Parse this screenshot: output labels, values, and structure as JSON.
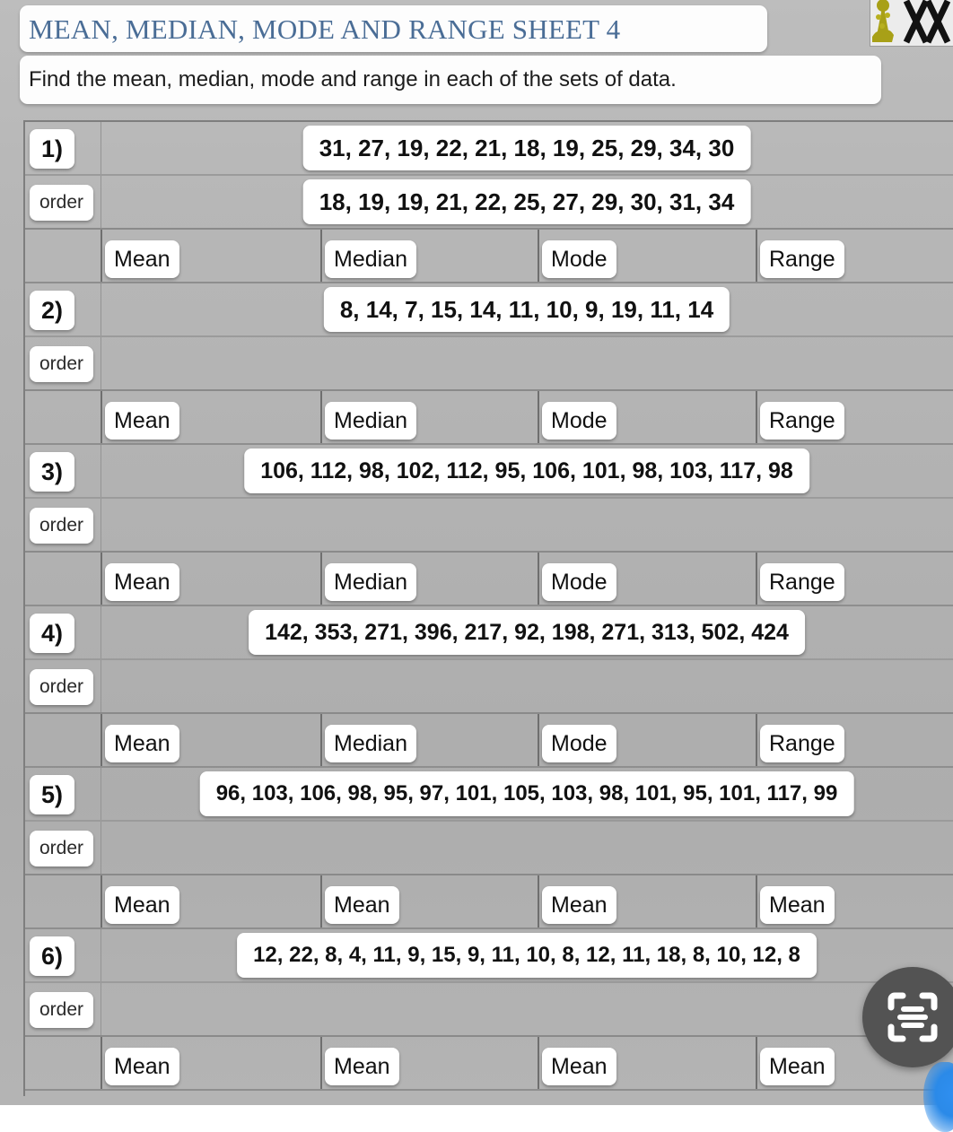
{
  "header": {
    "title": "MEAN, MEDIAN, MODE AND RANGE SHEET 4",
    "subtitle": "Find the mean, median, mode and range in each of the sets of data.",
    "title_color": "#4a6d96",
    "logo_icon": "math-salamanders-logo"
  },
  "table": {
    "order_label": "order",
    "groups": [
      {
        "number": "1)",
        "data": "31, 27, 19, 22, 21, 18, 19, 25, 29, 34, 30",
        "order": "18, 19, 19, 21, 22, 25, 27, 29, 30, 31, 34",
        "labels": [
          "Mean",
          "Median",
          "Mode",
          "Range"
        ]
      },
      {
        "number": "2)",
        "data": "8, 14, 7, 15, 14, 11, 10, 9, 19, 11, 14",
        "order": "",
        "labels": [
          "Mean",
          "Median",
          "Mode",
          "Range"
        ]
      },
      {
        "number": "3)",
        "data": "106, 112, 98, 102, 112, 95, 106, 101, 98, 103, 117, 98",
        "order": "",
        "labels": [
          "Mean",
          "Median",
          "Mode",
          "Range"
        ]
      },
      {
        "number": "4)",
        "data": "142, 353, 271, 396, 217, 92, 198, 271, 313, 502, 424",
        "order": "",
        "labels": [
          "Mean",
          "Median",
          "Mode",
          "Range"
        ]
      },
      {
        "number": "5)",
        "data": "96, 103, 106, 98, 95, 97, 101, 105, 103, 98, 101, 95, 101, 117, 99",
        "order": "",
        "labels": [
          "Mean",
          "Mean",
          "Mean",
          "Mean"
        ]
      },
      {
        "number": "6)",
        "data": "12, 22, 8, 4, 11, 9, 15, 9, 11, 10, 8, 12, 11, 18, 8, 10, 12, 8",
        "order": "",
        "labels": [
          "Mean",
          "Mean",
          "Mean",
          "Mean"
        ]
      }
    ]
  },
  "overlay": {
    "fab_icon": "text-scan-icon",
    "fab_color": "#535353",
    "accent_color": "#2b8ae8"
  }
}
